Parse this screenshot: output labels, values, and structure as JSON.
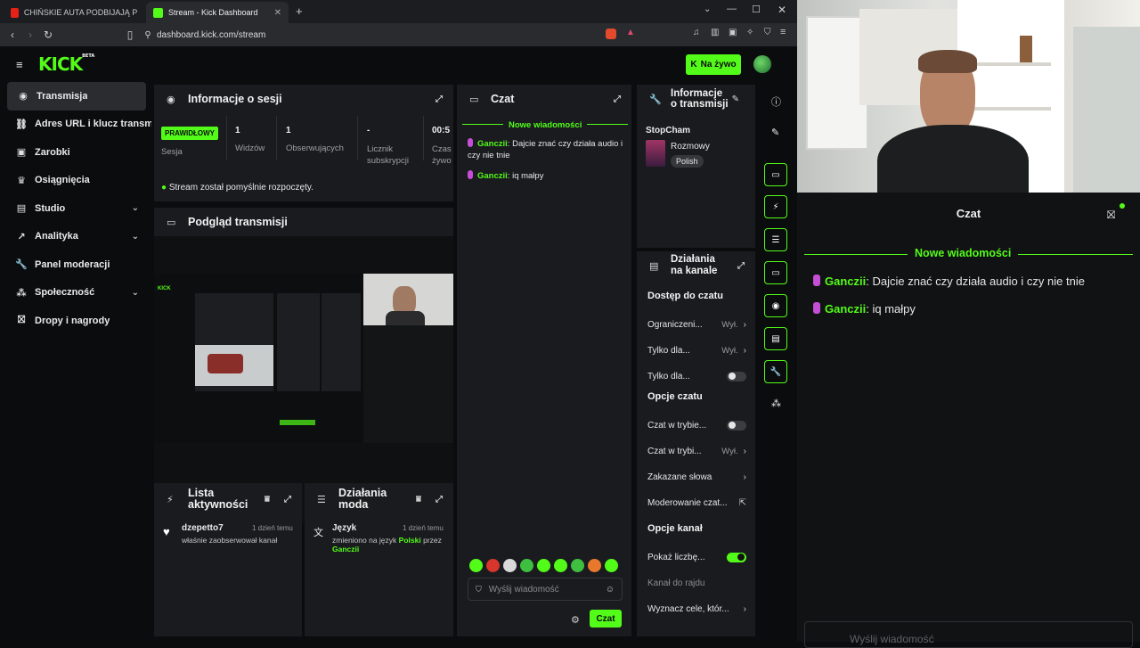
{
  "browser": {
    "tabs": [
      {
        "label": "CHIŃSKIE AUTA PODBIJAJĄ POLSKĘ",
        "active": false
      },
      {
        "label": "Stream - Kick Dashboard",
        "active": true
      }
    ],
    "url": "dashboard.kick.com/stream"
  },
  "app": {
    "logo": "KICK",
    "logo_badge": "BETA",
    "live_button": "Na żywo",
    "colors": {
      "accent": "#53fc18",
      "panel": "#191b1f",
      "bg": "#0b0c0e"
    }
  },
  "sidebar": {
    "items": [
      {
        "label": "Transmisja",
        "icon": "broadcast-icon",
        "active": true
      },
      {
        "label": "Adres URL i klucz transmisji",
        "icon": "link-icon"
      },
      {
        "label": "Zarobki",
        "icon": "wallet-icon"
      },
      {
        "label": "Osiągnięcia",
        "icon": "trophy-icon"
      },
      {
        "label": "Studio",
        "icon": "studio-icon",
        "expandable": true
      },
      {
        "label": "Analityka",
        "icon": "analytics-icon",
        "expandable": true
      },
      {
        "label": "Panel moderacji",
        "icon": "wrench-icon"
      },
      {
        "label": "Społeczność",
        "icon": "community-icon",
        "expandable": true
      },
      {
        "label": "Dropy i nagrody",
        "icon": "gift-icon"
      }
    ]
  },
  "session": {
    "title": "Informacje o sesji",
    "status_badge": "PRAWIDŁOWY",
    "session_label": "Sesja",
    "stats": [
      {
        "value": "1",
        "label": "Widzów"
      },
      {
        "value": "1",
        "label": "Obserwujących"
      },
      {
        "value": "-",
        "label": "Licznik subskrypcji"
      },
      {
        "value": "00:5",
        "label": "Czas żywo"
      }
    ],
    "success_msg": "Stream został pomyślnie rozpoczęty."
  },
  "preview": {
    "title": "Podgląd transmisji"
  },
  "activity": {
    "title": "Lista aktywności",
    "items": [
      {
        "user": "dzepetto7",
        "text": "właśnie zaobserwował kanał",
        "time": "1 dzień temu"
      }
    ]
  },
  "modactions": {
    "title": "Działania moda",
    "items": [
      {
        "action": "Język",
        "text_before": "zmieniono na język",
        "lang": "Polski",
        "by": "przez",
        "user": "Ganczii",
        "time": "1 dzień temu"
      }
    ]
  },
  "chat": {
    "title": "Czat",
    "new_messages": "Nowe wiadomości",
    "messages": [
      {
        "user": "Ganczii",
        "text": "Dajcie znać czy działa audio i czy nie tnie"
      },
      {
        "user": "Ganczii",
        "text": "iq małpy"
      }
    ],
    "placeholder": "Wyślij wiadomość",
    "send_label": "Czat"
  },
  "streaminfo": {
    "title": "Informacje o transmisji",
    "title_short": "StopCham",
    "category": "Rozmowy",
    "language": "Polish"
  },
  "channel_actions": {
    "title": "Działania na kanale",
    "sections": [
      {
        "title": "Dostęp do czatu",
        "rows": [
          {
            "label": "Ograniczeni...",
            "value": "Wył.",
            "type": "chevron"
          },
          {
            "label": "Tylko dla...",
            "value": "Wył.",
            "type": "chevron"
          },
          {
            "label": "Tylko dla...",
            "type": "toggle",
            "on": false
          }
        ]
      },
      {
        "title": "Opcje czatu",
        "rows": [
          {
            "label": "Czat w trybie...",
            "type": "toggle",
            "on": false
          },
          {
            "label": "Czat w trybi...",
            "value": "Wył.",
            "type": "chevron"
          },
          {
            "label": "Zakazane słowa",
            "type": "chevron"
          },
          {
            "label": "Moderowanie czat...",
            "type": "external"
          }
        ]
      },
      {
        "title": "Opcje kanał",
        "rows": [
          {
            "label": "Pokaż liczbę...",
            "type": "toggle",
            "on": true
          },
          {
            "label": "Kanał do rajdu",
            "type": "muted"
          },
          {
            "label": "Wyznacz cele, któr...",
            "type": "chevron"
          }
        ]
      }
    ]
  },
  "overlay": {
    "title": "Czat",
    "new_messages": "Nowe wiadomości",
    "messages": [
      {
        "user": "Ganczii",
        "text": "Dajcie znać czy działa audio i czy nie tnie"
      },
      {
        "user": "Ganczii",
        "text": "iq małpy"
      }
    ],
    "placeholder": "Wyślij wiadomość"
  }
}
